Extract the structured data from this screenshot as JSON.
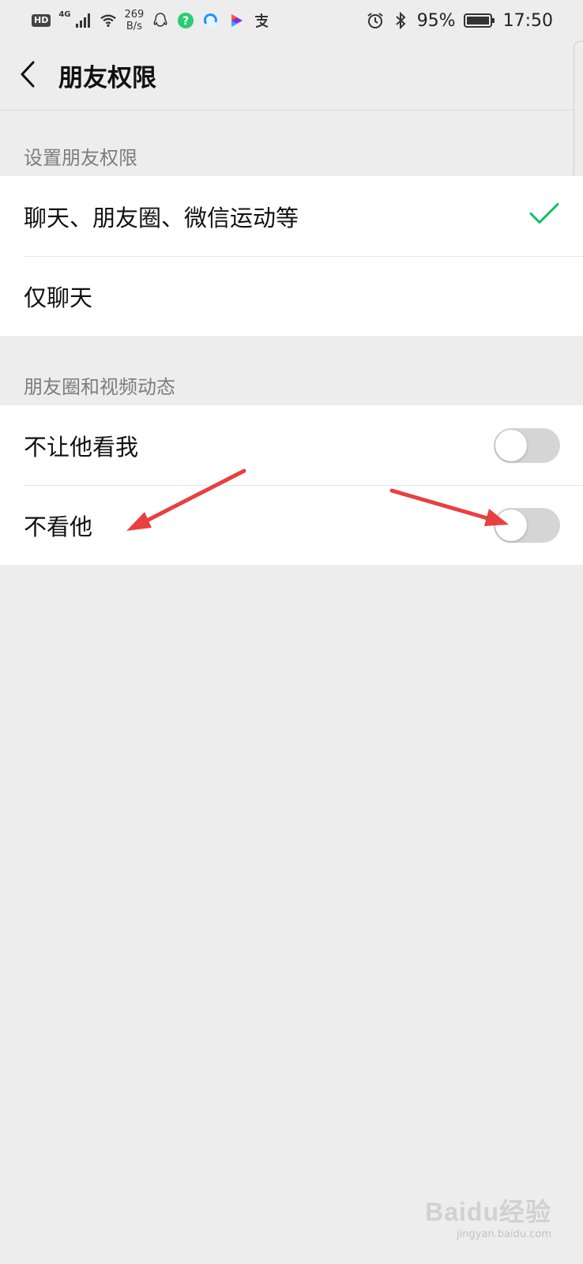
{
  "status_bar": {
    "hd": "HD",
    "network": "4G",
    "net_speed_value": "269",
    "net_speed_unit": "B/s",
    "battery_percent": "95%",
    "time": "17:50",
    "icons": [
      "signal-icon",
      "wifi-icon",
      "qq-icon",
      "question-app-icon",
      "browser-app-icon",
      "video-app-icon",
      "alipay-icon",
      "alarm-icon",
      "bluetooth-icon",
      "battery-icon"
    ]
  },
  "header": {
    "back_icon": "chevron-left-icon",
    "title": "朋友权限"
  },
  "sections": [
    {
      "label": "设置朋友权限",
      "rows": [
        {
          "label": "聊天、朋友圈、微信运动等",
          "selected": true,
          "control": "checkmark-icon"
        },
        {
          "label": "仅聊天",
          "selected": false
        }
      ]
    },
    {
      "label": "朋友圈和视频动态",
      "rows": [
        {
          "label": "不让他看我",
          "toggle_on": false
        },
        {
          "label": "不看他",
          "toggle_on": false
        }
      ]
    }
  ],
  "colors": {
    "background": "#ededed",
    "card": "#ffffff",
    "check_green": "#07c160",
    "toggle_off": "#d5d5d5",
    "annotation_arrow": "#e8403f"
  },
  "watermark": {
    "main": "Baidu经验",
    "sub": "jingyan.baidu.com"
  }
}
